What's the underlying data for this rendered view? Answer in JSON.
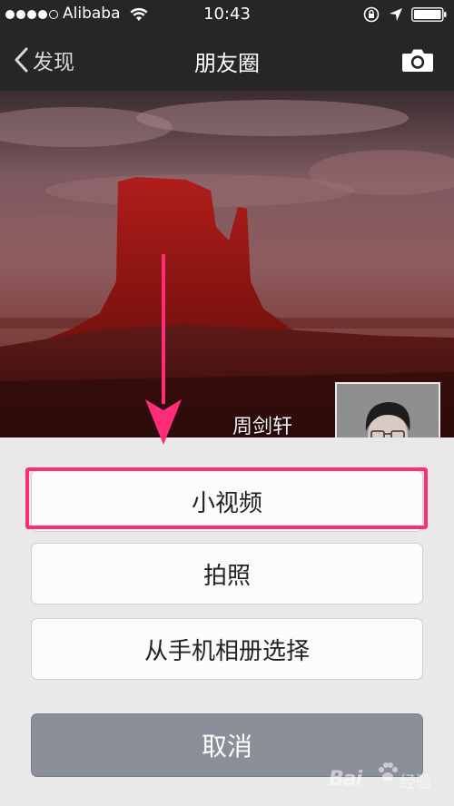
{
  "status_bar": {
    "carrier": "Alibaba",
    "time": "10:43",
    "signal_filled": 4,
    "signal_total": 5
  },
  "nav": {
    "back_label": "发现",
    "title": "朋友圈",
    "camera_icon": "camera-icon"
  },
  "cover": {
    "user_name": "周剑轩"
  },
  "action_sheet": {
    "items": [
      {
        "label": "小视频",
        "highlighted": true
      },
      {
        "label": "拍照"
      },
      {
        "label": "从手机相册选择"
      }
    ],
    "cancel_label": "取消"
  },
  "annotation": {
    "highlight_color": "#ff2d79"
  },
  "watermark": {
    "brand": "Bai",
    "brand_suffix": "经验"
  },
  "colors": {
    "nav_bg": "#262626",
    "sheet_bg": "#e9e9ea",
    "cancel_bg": "#8b8f99"
  }
}
